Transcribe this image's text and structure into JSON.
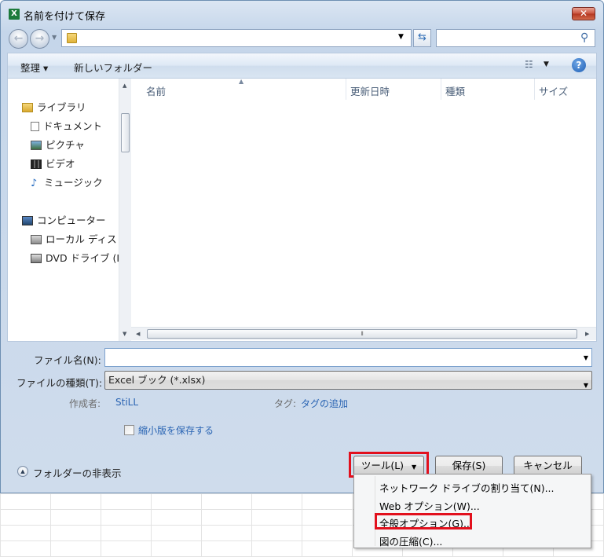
{
  "window": {
    "title": "名前を付けて保存",
    "close_glyph": "✕",
    "app_icon_letter": "X"
  },
  "address": {
    "path": "",
    "search_placeholder": ""
  },
  "toolbar": {
    "organize_label": "整理 ▾",
    "new_folder_label": "新しいフォルダー",
    "view_icon": "view-options-icon",
    "help_glyph": "?"
  },
  "nav": {
    "items": [
      {
        "label": "ライブラリ",
        "icon": "library-icon"
      },
      {
        "label": "ドキュメント",
        "icon": "document-icon"
      },
      {
        "label": "ピクチャ",
        "icon": "picture-icon"
      },
      {
        "label": "ビデオ",
        "icon": "video-icon"
      },
      {
        "label": "ミュージック",
        "icon": "music-icon"
      },
      {
        "label": "コンピューター",
        "icon": "computer-icon"
      },
      {
        "label": "ローカル ディス",
        "icon": "local-disk-icon"
      },
      {
        "label": "DVD ドライブ (I",
        "icon": "dvd-drive-icon"
      }
    ]
  },
  "columns": {
    "name": "名前",
    "modified": "更新日時",
    "type": "種類",
    "size": "サイズ"
  },
  "form": {
    "filename_label": "ファイル名(N):",
    "filename_value": "",
    "filetype_label": "ファイルの種類(T):",
    "filetype_value": "Excel ブック (*.xlsx)",
    "author_label": "作成者:",
    "author_value": "StiLL",
    "tags_label": "タグ:",
    "tags_value": "タグの追加",
    "thumbnail_label": "縮小版を保存する",
    "hide_folders_label": "フォルダーの非表示"
  },
  "buttons": {
    "tools": "ツール(L)",
    "save": "保存(S)",
    "cancel": "キャンセル"
  },
  "tools_menu": {
    "items": [
      "ネットワーク ドライブの割り当て(N)...",
      "Web オプション(W)...",
      "全般オプション(G)...",
      "図の圧縮(C)..."
    ]
  },
  "colors": {
    "highlight": "#e2101d",
    "link": "#2a64b3"
  }
}
